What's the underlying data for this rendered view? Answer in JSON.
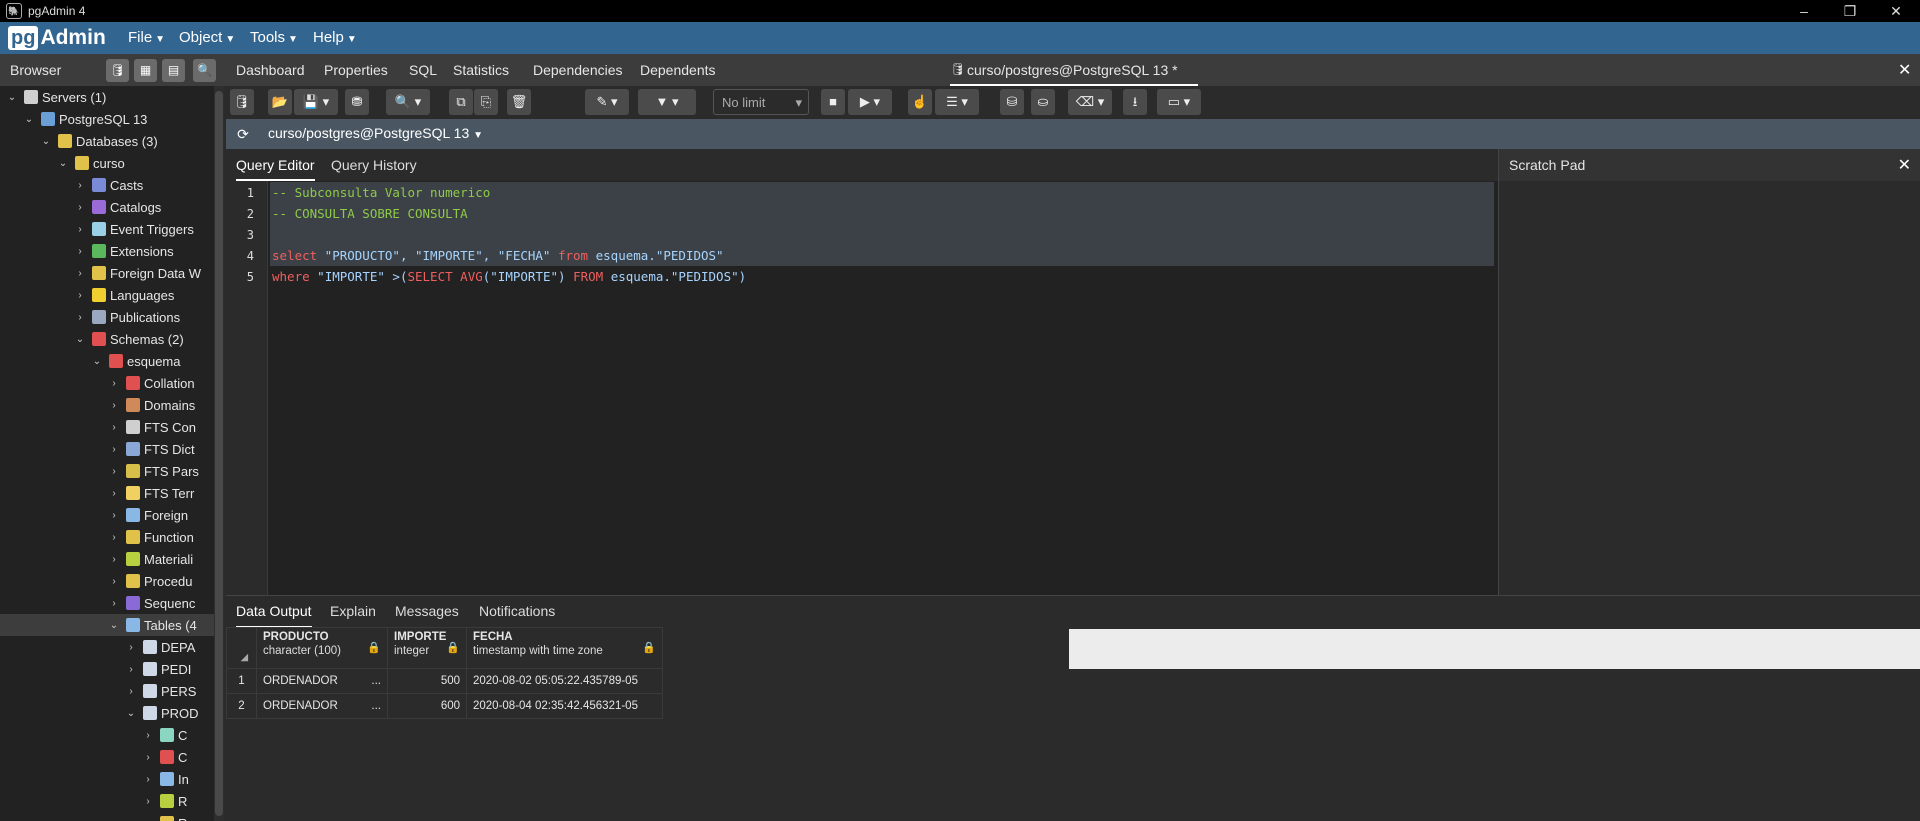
{
  "window": {
    "title": "pgAdmin 4",
    "controls": [
      "–",
      "❐",
      "✕"
    ]
  },
  "brand": {
    "pg": "pg",
    "admin": "Admin"
  },
  "menu": [
    "File",
    "Object",
    "Tools",
    "Help"
  ],
  "browser": {
    "label": "Browser"
  },
  "tree": [
    {
      "label": "Servers (1)",
      "indent": 0,
      "expanded": true,
      "color": "#cfcfcf"
    },
    {
      "label": "PostgreSQL 13",
      "indent": 1,
      "expanded": true,
      "color": "#6aa0d6"
    },
    {
      "label": "Databases (3)",
      "indent": 2,
      "expanded": true,
      "color": "#e0c24a"
    },
    {
      "label": "curso",
      "indent": 3,
      "expanded": true,
      "color": "#e0c24a"
    },
    {
      "label": "Casts",
      "indent": 4,
      "expanded": false,
      "color": "#7a8ad6"
    },
    {
      "label": "Catalogs",
      "indent": 4,
      "expanded": false,
      "color": "#9a6ad6"
    },
    {
      "label": "Event Triggers",
      "indent": 4,
      "expanded": false,
      "color": "#9ad0e6"
    },
    {
      "label": "Extensions",
      "indent": 4,
      "expanded": false,
      "color": "#5cb85c"
    },
    {
      "label": "Foreign Data W",
      "indent": 4,
      "expanded": false,
      "color": "#e0c24a"
    },
    {
      "label": "Languages",
      "indent": 4,
      "expanded": false,
      "color": "#f0d030"
    },
    {
      "label": "Publications",
      "indent": 4,
      "expanded": false,
      "color": "#9aa8c0"
    },
    {
      "label": "Schemas (2)",
      "indent": 4,
      "expanded": true,
      "color": "#e05050"
    },
    {
      "label": "esquema",
      "indent": 5,
      "expanded": true,
      "color": "#e05050"
    },
    {
      "label": "Collation",
      "indent": 6,
      "expanded": false,
      "color": "#e05050"
    },
    {
      "label": "Domains",
      "indent": 6,
      "expanded": false,
      "color": "#d08a5a"
    },
    {
      "label": "FTS Con",
      "indent": 6,
      "expanded": false,
      "color": "#cfcfcf"
    },
    {
      "label": "FTS Dict",
      "indent": 6,
      "expanded": false,
      "color": "#8aa8d6"
    },
    {
      "label": "FTS Pars",
      "indent": 6,
      "expanded": false,
      "color": "#d6c04a"
    },
    {
      "label": "FTS Terr",
      "indent": 6,
      "expanded": false,
      "color": "#f0d060"
    },
    {
      "label": "Foreign",
      "indent": 6,
      "expanded": false,
      "color": "#8ab8e6"
    },
    {
      "label": "Function",
      "indent": 6,
      "expanded": false,
      "color": "#e0c24a"
    },
    {
      "label": "Materiali",
      "indent": 6,
      "expanded": false,
      "color": "#b8d040"
    },
    {
      "label": "Procedu",
      "indent": 6,
      "expanded": false,
      "color": "#e0c24a"
    },
    {
      "label": "Sequenc",
      "indent": 6,
      "expanded": false,
      "color": "#8a6ad6"
    },
    {
      "label": "Tables (4",
      "indent": 6,
      "expanded": true,
      "color": "#8ab8e6",
      "selected": true
    },
    {
      "label": "DEPA",
      "indent": 7,
      "expanded": false,
      "color": "#cfd8e6"
    },
    {
      "label": "PEDI",
      "indent": 7,
      "expanded": false,
      "color": "#cfd8e6"
    },
    {
      "label": "PERS",
      "indent": 7,
      "expanded": false,
      "color": "#cfd8e6"
    },
    {
      "label": "PROD",
      "indent": 7,
      "expanded": true,
      "color": "#cfd8e6"
    },
    {
      "label": "C",
      "indent": 8,
      "expanded": false,
      "color": "#8ad6c0"
    },
    {
      "label": "C",
      "indent": 8,
      "expanded": false,
      "color": "#e05050"
    },
    {
      "label": "In",
      "indent": 8,
      "expanded": false,
      "color": "#8ab8e6"
    },
    {
      "label": "R",
      "indent": 8,
      "expanded": false,
      "color": "#b8d040"
    },
    {
      "label": "R",
      "indent": 8,
      "expanded": false,
      "color": "#e0c24a"
    }
  ],
  "tabs": [
    "Dashboard",
    "Properties",
    "SQL",
    "Statistics",
    "Dependencies",
    "Dependents",
    "curso/postgres@PostgreSQL 13 *"
  ],
  "toolbar": {
    "limit": "No limit"
  },
  "connection": {
    "label": "curso/postgres@PostgreSQL 13"
  },
  "query_tabs": {
    "editor": "Query Editor",
    "history": "Query History"
  },
  "scratch": {
    "label": "Scratch Pad"
  },
  "code": {
    "line_numbers": [
      "1",
      "2",
      "3",
      "4",
      "5"
    ],
    "line1": "-- Subconsulta Valor numerico",
    "line2": "-- CONSULTA SOBRE CONSULTA",
    "line4_kw1": "select",
    "line4_a": " \"PRODUCTO\", \"IMPORTE\", \"FECHA\" ",
    "line4_kw2": "from",
    "line4_b": " esquema.\"PEDIDOS\"",
    "line5_kw1": "where",
    "line5_a": " \"IMPORTE\" >(",
    "line5_kw2": "SELECT AVG",
    "line5_b": "(\"IMPORTE\") ",
    "line5_kw3": "FROM",
    "line5_c": " esquema.\"PEDIDOS\")"
  },
  "result_tabs": [
    "Data Output",
    "Explain",
    "Messages",
    "Notifications"
  ],
  "grid": {
    "columns": [
      {
        "name": "PRODUCTO",
        "type": "character (100)"
      },
      {
        "name": "IMPORTE",
        "type": "integer"
      },
      {
        "name": "FECHA",
        "type": "timestamp with time zone"
      }
    ],
    "rows": [
      {
        "n": "1",
        "producto": "ORDENADOR",
        "importe": "500",
        "fecha": "2020-08-02 05:05:22.435789-05"
      },
      {
        "n": "2",
        "producto": "ORDENADOR",
        "importe": "600",
        "fecha": "2020-08-04 02:35:42.456321-05"
      }
    ],
    "ellipsis": "..."
  }
}
